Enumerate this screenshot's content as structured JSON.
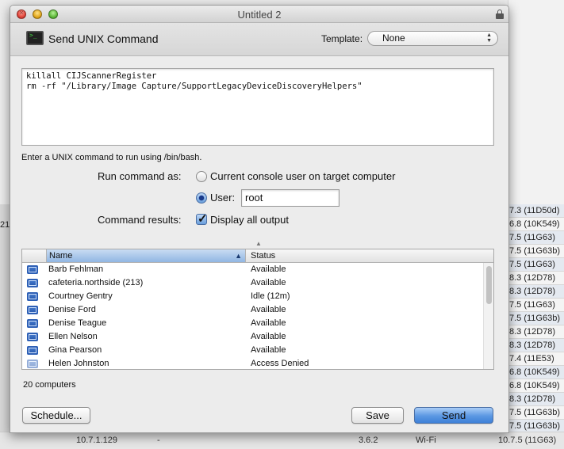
{
  "background": {
    "right_column": [
      "7.3 (11D50d)",
      "6.8 (10K549)",
      "7.5 (11G63)",
      "7.5 (11G63b)",
      "7.5 (11G63)",
      "8.3 (12D78)",
      "8.3 (12D78)",
      "7.5 (11G63)",
      "7.5 (11G63b)",
      "8.3 (12D78)",
      "8.3 (12D78)",
      "7.4 (11E53)",
      "6.8 (10K549)",
      "6.8 (10K549)",
      "8.3 (12D78)",
      "7.5 (11G63b)",
      "7.5 (11G63b)"
    ],
    "left_fragment": "21",
    "bottom_row": {
      "c1": "10.7.1.129",
      "c2": "-",
      "c3": "3.6.2",
      "c4": "Wi-Fi",
      "c5": "10.7.5 (11G63)"
    }
  },
  "window": {
    "title": "Untitled 2"
  },
  "header": {
    "title": "Send UNIX Command",
    "template_label": "Template:",
    "template_value": "None"
  },
  "command": {
    "text": "killall CIJScannerRegister\nrm -rf \"/Library/Image Capture/SupportLegacyDeviceDiscoveryHelpers\"",
    "hint": "Enter a UNIX command to run using /bin/bash."
  },
  "run_as": {
    "label": "Run command as:",
    "option_console": "Current console user on target computer",
    "option_user": "User:",
    "user_value": "root",
    "selected": "user"
  },
  "results": {
    "label": "Command results:",
    "checkbox_label": "Display all output",
    "checked": true
  },
  "table": {
    "col_name": "Name",
    "col_status": "Status",
    "rows": [
      {
        "name": "Barb Fehlman",
        "status": "Available"
      },
      {
        "name": "cafeteria.northside (213)",
        "status": "Available"
      },
      {
        "name": "Courtney Gentry",
        "status": "Idle (12m)"
      },
      {
        "name": "Denise Ford",
        "status": "Available"
      },
      {
        "name": "Denise Teague",
        "status": "Available"
      },
      {
        "name": "Ellen Nelson",
        "status": "Available"
      },
      {
        "name": "Gina Pearson",
        "status": "Available"
      },
      {
        "name": "Helen Johnston",
        "status": "Access Denied"
      }
    ]
  },
  "footer": {
    "count": "20 computers",
    "schedule": "Schedule...",
    "save": "Save",
    "send": "Send"
  }
}
